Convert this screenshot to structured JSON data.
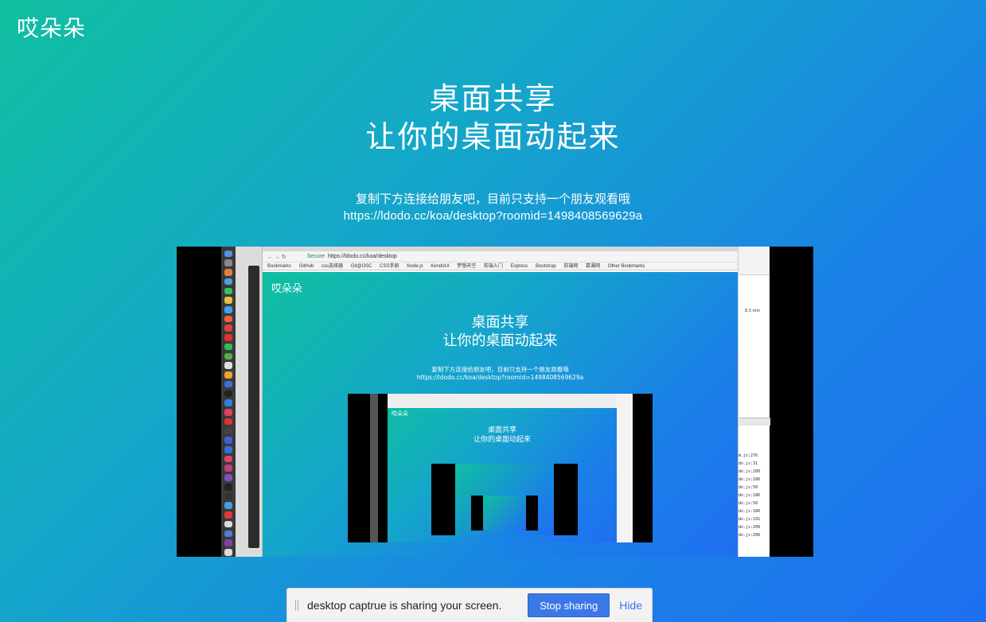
{
  "app": {
    "logo": "哎朵朵"
  },
  "hero": {
    "line1": "桌面共享",
    "line2": "让你的桌面动起来"
  },
  "share": {
    "instruction": "复制下方连接给朋友吧，目前只支持一个朋友观看哦",
    "url": "https://ldodo.cc/koa/desktop?roomid=1498408569629a"
  },
  "preview": {
    "address_secure": "Secure",
    "address_url": "https://ldodo.cc/koa/desktop",
    "bookmarks": [
      "Bookmarks",
      "GitHub",
      "css选择器",
      "Git@OSC",
      "CSS手册",
      "Node.js",
      "KendoUI",
      "梦想天空",
      "前端入门",
      "Express",
      "Bootstrap",
      "前端网",
      "慕课网",
      "Other Bookmarks"
    ],
    "inner_logo": "哎朵朵",
    "inner_hero_line1": "桌面共享",
    "inner_hero_line2": "让你的桌面动起来",
    "inner_instruction": "复制下方连接给朋友吧，目前只支持一个朋友观看哦",
    "inner_url": "https://ldodo.cc/koa/desktop?roomid=1498408569629a",
    "inner2_logo": "哎朵朵",
    "inner2_line1": "桌面共享",
    "inner2_line2": "让你的桌面动起来",
    "devtools_size": "8.3 min",
    "devtools_lines": [
      "m.js:276",
      "do.js:31",
      "do.js:200",
      "do.js:186",
      "do.js:50",
      "do.js:186",
      "do.js:50",
      "do.js:186",
      "do.js:191",
      "do.js:200",
      "do.js:200"
    ]
  },
  "sharebar": {
    "message": "desktop captrue is sharing your screen.",
    "stop_label": "Stop sharing",
    "hide_label": "Hide"
  },
  "colors": {
    "gradient_start": "#10bfa0",
    "gradient_end": "#1f6ff0",
    "button_blue": "#3b78e7"
  }
}
